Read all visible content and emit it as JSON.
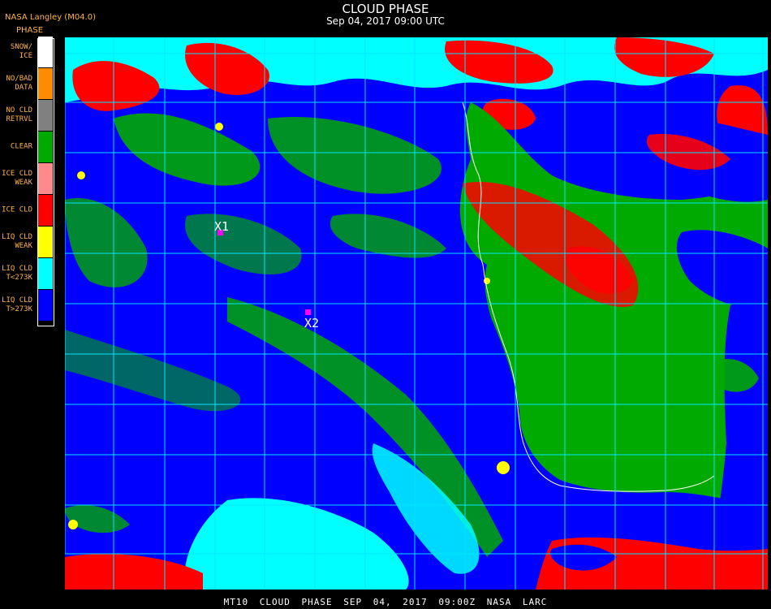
{
  "header": {
    "source": "NASA Langley (M04.0)",
    "phase_label": "PHASE",
    "title": "CLOUD PHASE",
    "subtitle": "Sep 04, 2017 09:00 UTC"
  },
  "legend": {
    "items": [
      {
        "label": "SNOW/\nICE",
        "color": "#ffffff"
      },
      {
        "label": "NO/BAD\nDATA",
        "color": "#ff8c00"
      },
      {
        "label": "NO CLD\nRETRVL",
        "color": "#808080"
      },
      {
        "label": "CLEAR",
        "color": "#00aa00"
      },
      {
        "label": "ICE CLD\nWEAK",
        "color": "#ff8a8a"
      },
      {
        "label": "ICE CLD",
        "color": "#ff0000"
      },
      {
        "label": "LIQ CLD\nWEAK",
        "color": "#ffff00"
      },
      {
        "label": "LIQ CLD\nT<273K",
        "color": "#00ffff"
      },
      {
        "label": "LIQ CLD\nT>273K",
        "color": "#0000ff"
      }
    ]
  },
  "markers": [
    {
      "label": "X1"
    },
    {
      "label": "X2"
    }
  ],
  "footer": {
    "text": "MT10 CLOUD PHASE SEP 04, 2017 09:00Z NASA LARC"
  },
  "colors": {
    "background": "#000000",
    "grid": "#00e5ff",
    "marker": "#ff00ff",
    "legend_text": "#ffb347"
  }
}
